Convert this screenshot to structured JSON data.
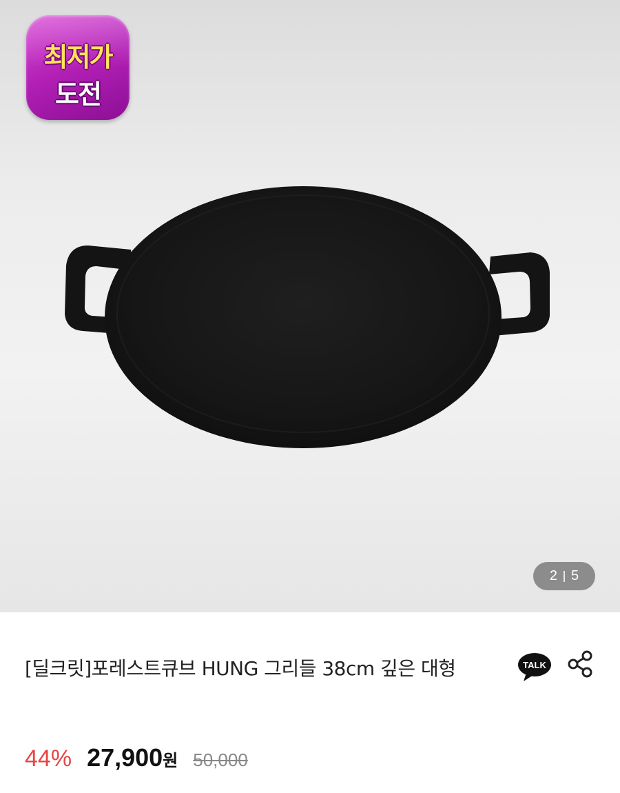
{
  "gallery": {
    "badge": {
      "line1": "최저가",
      "line2": "도전",
      "color": "#b21fb5"
    },
    "counter": {
      "current": "2",
      "total": "5"
    },
    "image_subject": "black-round-griddle-pan"
  },
  "product": {
    "title": "[딜크릿]포레스트큐브 HUNG 그리들 38cm 깊은 대형",
    "talk_label": "TALK",
    "share_icon": "share-icon"
  },
  "pricing": {
    "discount": "44%",
    "price": "27,900",
    "currency": "원",
    "original_price": "50,000",
    "discount_color": "#e84545"
  }
}
